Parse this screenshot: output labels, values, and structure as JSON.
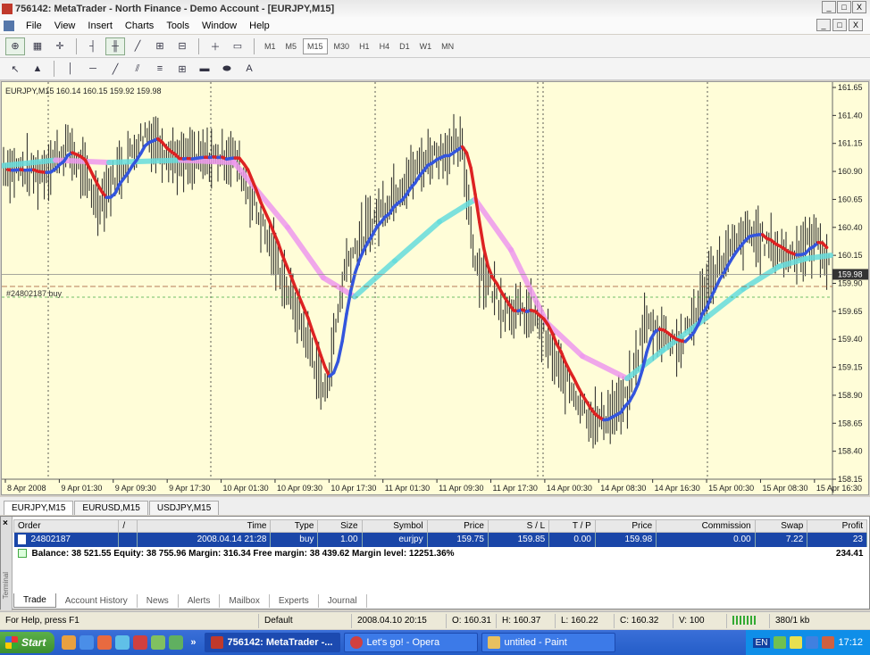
{
  "window": {
    "title": "756142: MetaTrader - North Finance - Demo Account - [EURJPY,M15]",
    "minimize": "_",
    "restore": "□",
    "close": "X"
  },
  "menu": [
    "File",
    "View",
    "Insert",
    "Charts",
    "Tools",
    "Window",
    "Help"
  ],
  "toolbar": {
    "periods": [
      "M1",
      "M5",
      "M15",
      "M30",
      "H1",
      "H4",
      "D1",
      "W1",
      "MN"
    ],
    "active_period": "M15",
    "text_tool": "A"
  },
  "chart": {
    "label": "EURJPY,M15  160.14 160.15 159.92 159.98",
    "order_label": "#24802187 buy",
    "current_price": "159.98",
    "price_ticks": [
      "161.65",
      "161.40",
      "161.15",
      "160.90",
      "160.65",
      "160.40",
      "160.15",
      "159.90",
      "159.65",
      "159.40",
      "159.15",
      "158.90",
      "158.65",
      "158.40",
      "158.15"
    ],
    "time_ticks": [
      "8 Apr 2008",
      "9 Apr 01:30",
      "9 Apr 09:30",
      "9 Apr 17:30",
      "10 Apr 01:30",
      "10 Apr 09:30",
      "10 Apr 17:30",
      "11 Apr 01:30",
      "11 Apr 09:30",
      "11 Apr 17:30",
      "14 Apr 00:30",
      "14 Apr 08:30",
      "14 Apr 16:30",
      "15 Apr 00:30",
      "15 Apr 08:30",
      "15 Apr 16:30"
    ],
    "colors": {
      "background": "#fffdd8",
      "fast_ma": "#3355dd",
      "fast_ma_down": "#dd2222",
      "slow_ma": "#ee99ee",
      "slow_ma_up": "#66dddd",
      "bars": "#222222"
    },
    "price_min": 158.15,
    "price_max": 161.65
  },
  "chart_tabs": [
    "EURJPY,M15",
    "EURUSD,M15",
    "USDJPY,M15"
  ],
  "terminal": {
    "side_label": "Terminal",
    "close": "×",
    "headers": [
      "Order",
      "/",
      "Time",
      "Type",
      "Size",
      "Symbol",
      "Price",
      "S / L",
      "T / P",
      "Price",
      "Commission",
      "Swap",
      "Profit"
    ],
    "row": [
      "24802187",
      "",
      "2008.04.14 21:28",
      "buy",
      "1.00",
      "eurjpy",
      "159.75",
      "159.85",
      "0.00",
      "159.98",
      "0.00",
      "7.22",
      "23"
    ],
    "balance_text": "Balance: 38 521.55  Equity: 38 755.96  Margin: 316.34  Free margin: 38 439.62  Margin level: 12251.36%",
    "balance_profit": "234.41",
    "tabs": [
      "Trade",
      "Account History",
      "News",
      "Alerts",
      "Mailbox",
      "Experts",
      "Journal"
    ],
    "active_tab": "Trade"
  },
  "status": {
    "help": "For Help, press F1",
    "profile": "Default",
    "datetime": "2008.04.10 20:15",
    "open": "O: 160.31",
    "high": "H: 160.37",
    "low": "L: 160.22",
    "close": "C: 160.32",
    "volume": "V: 100",
    "traffic": "380/1 kb"
  },
  "taskbar": {
    "start": "Start",
    "more": "»",
    "tasks": [
      "756142: MetaTrader -...",
      "Let's go! - Opera",
      "untitled - Paint"
    ],
    "lang": "EN",
    "clock": "17:12"
  }
}
